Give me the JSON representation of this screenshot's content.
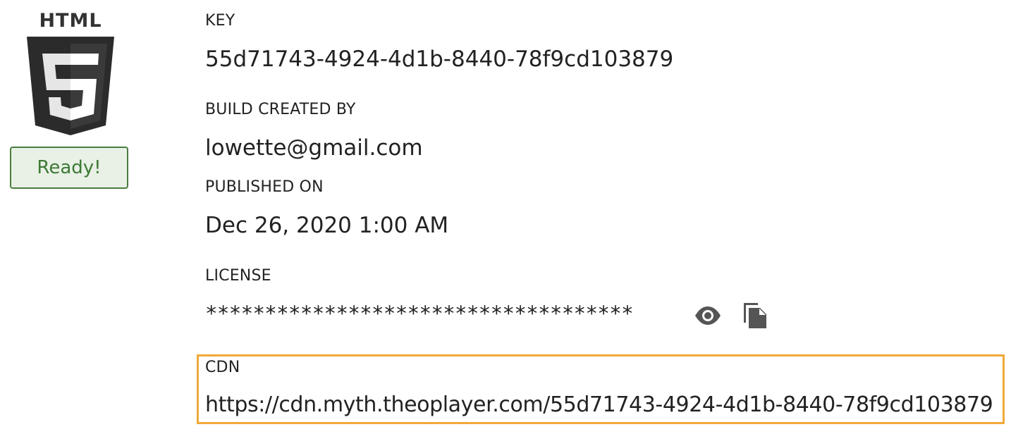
{
  "build": {
    "platform_icon": "html5-icon",
    "status": "Ready!"
  },
  "fields": {
    "key": {
      "label": "KEY",
      "value": "55d71743-4924-4d1b-8440-78f9cd103879"
    },
    "created_by": {
      "label": "BUILD CREATED BY",
      "value": "lowette@gmail.com"
    },
    "published_on": {
      "label": "PUBLISHED ON",
      "value": "Dec 26, 2020 1:00 AM"
    },
    "license": {
      "label": "LICENSE",
      "value": "************************************"
    },
    "cdn": {
      "label": "CDN",
      "value": "https://cdn.myth.theoplayer.com/55d71743-4924-4d1b-8440-78f9cd103879"
    }
  },
  "actions": {
    "reveal_icon": "eye-icon",
    "copy_icon": "copy-icon"
  },
  "colors": {
    "status_text": "#3c7a33",
    "status_border": "#4a7c3f",
    "status_background": "#e9f1e7",
    "highlight_border": "#f0a93a",
    "icon": "#555555"
  }
}
